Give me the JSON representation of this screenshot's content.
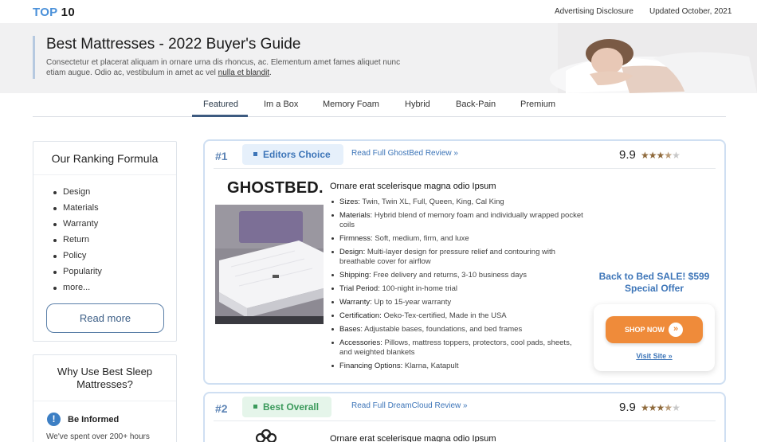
{
  "header": {
    "logo_top": "TOP",
    "logo_num": "10",
    "disclosure": "Advertising Disclosure",
    "updated": "Updated October, 2021"
  },
  "hero": {
    "title": "Best Mattresses - 2022 Buyer's Guide",
    "description": "Consectetur et placerat aliquam in ornare urna dis rhoncus, ac. Elementum amet fames aliquet nunc etiam augue. Odio ac, vestibulum in amet ac vel",
    "link": "nulla et blandit",
    "trailing": "."
  },
  "tabs": [
    "Featured",
    "Im a Box",
    "Memory Foam",
    "Hybrid",
    "Back-Pain",
    "Premium"
  ],
  "active_tab": "Featured",
  "ranking": {
    "title": "Our Ranking Formula",
    "items": [
      "Design",
      "Materials",
      "Warranty",
      "Return",
      "Policy",
      "Popularity",
      "more..."
    ],
    "read_more": "Read more"
  },
  "why": {
    "title": "Why Use Best Sleep Mattresses?",
    "info_title": "Be Informed",
    "info_text": "We've spent over 200+ hours"
  },
  "products": [
    {
      "rank": "#1",
      "badge": "Editors Choice",
      "review_link": "Read Full GhostBed Review »",
      "score": "9.9",
      "rating_stars": 4.5,
      "brand": "GHOSTBED.",
      "headline": "Ornare erat scelerisque magna odio Ipsum",
      "features": [
        {
          "label": "Sizes:",
          "text": "Twin, Twin XL, Full, Queen, King, Cal King"
        },
        {
          "label": "Materials:",
          "text": "Hybrid blend of memory foam and individually wrapped pocket coils"
        },
        {
          "label": "Firmness:",
          "text": "Soft, medium, firm, and luxe"
        },
        {
          "label": "Design:",
          "text": "Multi-layer design for pressure relief and contouring with breathable cover for airflow"
        },
        {
          "label": "Shipping:",
          "text": "Free delivery and returns, 3-10 business days"
        },
        {
          "label": "Trial Period:",
          "text": "100-night in-home trial"
        },
        {
          "label": "Warranty:",
          "text": "Up to 15-year warranty"
        },
        {
          "label": "Certification:",
          "text": "Oeko-Tex-certified, Made in the USA"
        },
        {
          "label": "Bases:",
          "text": "Adjustable bases, foundations, and bed frames"
        },
        {
          "label": "Accessories:",
          "text": "Pillows, mattress toppers, protectors, cool pads, sheets, and weighted blankets"
        },
        {
          "label": "Financing Options:",
          "text": "Klarna, Katapult"
        }
      ],
      "offer": "Back to Bed SALE! $599 Special Offer",
      "cta": "SHOP NOW",
      "visit": "Visit Site »"
    },
    {
      "rank": "#2",
      "badge": "Best Overall",
      "review_link": "Read Full DreamCloud Review »",
      "score": "9.9",
      "rating_stars": 4.5,
      "headline": "Ornare erat scelerisque magna odio Ipsum"
    }
  ],
  "colors": {
    "accent_blue": "#3d75b8",
    "cta_orange": "#ef8b3a",
    "badge_green": "#3b9a5c",
    "star_brown": "#8f6a3c"
  }
}
